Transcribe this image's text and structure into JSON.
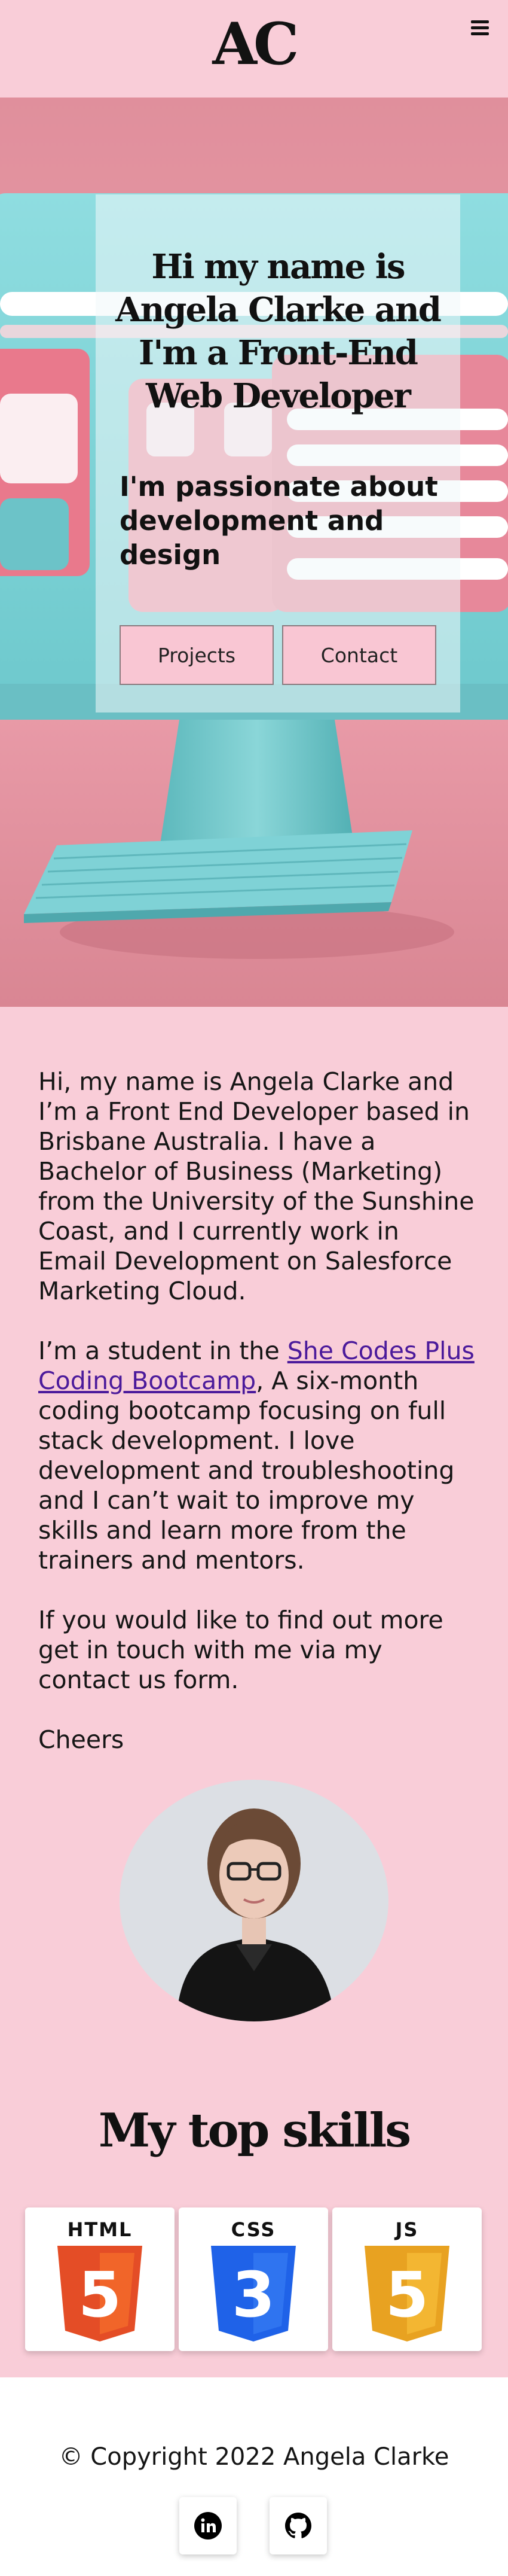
{
  "header": {
    "logo": "AC",
    "menu_icon": "hamburger-menu-icon"
  },
  "hero": {
    "title": "Hi my name is Angela Clarke and I'm a Front-End Web Developer",
    "subtitle": "I'm passionate about development and design",
    "buttons": {
      "projects": "Projects",
      "contact": "Contact"
    }
  },
  "about": {
    "p1": "Hi, my name is Angela Clarke and I’m a Front End Developer based in Brisbane Australia. I have a Bachelor of Business (Marketing) from the University of the Sunshine Coast, and I currently work in Email Development on Salesforce Marketing Cloud.",
    "p2_before": "I’m a student in the ",
    "p2_link": "She Codes Plus Coding Bootcamp",
    "p2_after": ", A six-month coding bootcamp focusing on full stack development. I love development and troubleshooting and I can’t wait to improve my skills and learn more from the trainers and mentors.",
    "p3": "If you would like to find out more get in touch with me via my contact us form.",
    "signoff": "Cheers"
  },
  "skills": {
    "title": "My top skills",
    "items": [
      {
        "name": "HTML",
        "number": "5",
        "color": "#e44d26",
        "shade": "#f16529"
      },
      {
        "name": "CSS",
        "number": "3",
        "color": "#1f62e8",
        "shade": "#2f74f0"
      },
      {
        "name": "JS",
        "number": "5",
        "color": "#e8a221",
        "shade": "#f3b632"
      }
    ]
  },
  "footer": {
    "copyright": "© Copyright 2022 Angela Clarke",
    "social": [
      "linkedin-icon",
      "github-icon"
    ]
  },
  "colors": {
    "page_bg": "#f9cdd8",
    "button_bg": "#f9c6d3",
    "link": "#4b1a9b"
  }
}
